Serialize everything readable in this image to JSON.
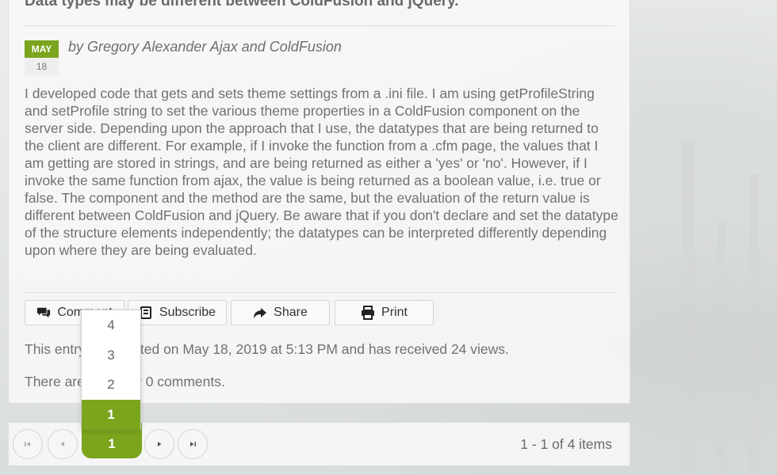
{
  "post": {
    "title": "Data types may be different between ColdFusion and jQuery.",
    "date": {
      "month": "MAY",
      "day": "18"
    },
    "byline": "by Gregory Alexander Ajax and ColdFusion",
    "body": "I developed code that gets and sets theme settings from a .ini file. I am using getProfileString and setProfile string to set the various theme properties in a ColdFusion component on the server side. Depending upon the approach that I use, the datatypes that are being returned to the client are different. For example, if I invoke the function from a .cfm page, the values that I am getting are stored in strings, and are being returned as either a 'yes' or 'no'. However, if I invoke the same function from ajax, the value is being returned as a boolean value, i.e. true or false. The component and the method are the same, but the evaluation of the return value is different between ColdFusion and jQuery. Be aware that if you don't declare and set the datatype of the structure elements independently; the datatypes can be interpreted differently depending upon where they are being evaluated.",
    "posted_info": "This entry was posted on May 18, 2019 at 5:13 PM and has received 24 views.",
    "comments_info": "There are currently 0 comments."
  },
  "actions": {
    "comment_label": "Comment",
    "subscribe_label": "Subscribe",
    "share_label": "Share",
    "print_label": "Print"
  },
  "pager": {
    "current_page": "1",
    "items_info": "1 - 1 of 4 items",
    "page_size_options": [
      "4",
      "3",
      "2",
      "1"
    ],
    "page_size_selected": "1"
  },
  "colors": {
    "accent": "#7aa51c",
    "text": "#717171",
    "panel": "#f8f8f8"
  },
  "icons": {
    "comment": "comments-icon",
    "subscribe": "subscribe-icon",
    "share": "share-icon",
    "print": "print-icon",
    "first": "first-page-icon",
    "prev": "previous-page-icon",
    "next": "next-page-icon",
    "last": "last-page-icon"
  }
}
